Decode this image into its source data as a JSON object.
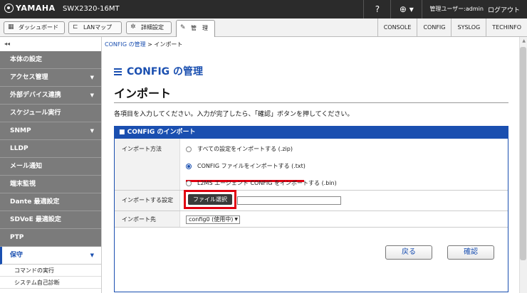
{
  "topbar": {
    "brand": "YAMAHA",
    "model": "SWX2320-16MT",
    "help": "?",
    "globe": "⊕ ▾",
    "user": "管理ユーザー:admin",
    "logout": "ログアウト"
  },
  "nav": {
    "dashboard": "ダッシュボード",
    "lanmap": "LANマップ",
    "detail": "詳細設定",
    "manage": "管　理",
    "links": [
      "CONSOLE",
      "CONFIG",
      "SYSLOG",
      "TECHINFO"
    ]
  },
  "collapse": "◂◂",
  "sidebar": {
    "items": [
      {
        "label": "本体の設定",
        "arrow": ""
      },
      {
        "label": "アクセス管理",
        "arrow": "▼"
      },
      {
        "label": "外部デバイス連携",
        "arrow": "▼"
      },
      {
        "label": "スケジュール実行",
        "arrow": ""
      },
      {
        "label": "SNMP",
        "arrow": "▼"
      },
      {
        "label": "LLDP",
        "arrow": ""
      },
      {
        "label": "メール通知",
        "arrow": ""
      },
      {
        "label": "端末監視",
        "arrow": ""
      },
      {
        "label": "Dante 最適設定",
        "arrow": ""
      },
      {
        "label": "SDVoE 最適設定",
        "arrow": ""
      },
      {
        "label": "PTP",
        "arrow": ""
      }
    ],
    "active": {
      "label": "保守",
      "arrow": "▼"
    },
    "subitems": [
      "コマンドの実行",
      "システム自己診断"
    ]
  },
  "breadcrumb": {
    "link": "CONFIG の管理",
    "sep": " > ",
    "current": "インポート"
  },
  "page": {
    "title": "CONFIG の管理",
    "subtitle": "インポート",
    "description": "各項目を入力してください。入力が完了したら、「確認」ボタンを押してください。"
  },
  "panel": {
    "header": "■ CONFIG のインポート",
    "method_label": "インポート方法",
    "options": [
      "すべての設定をインポートする (.zip)",
      "CONFIG ファイルをインポートする (.txt)",
      "L2MS エージェント CONFIG をインポートする (.bin)"
    ],
    "selected_option": 1,
    "file_label": "インポートする設定",
    "file_button": "ファイル選択",
    "dest_label": "インポート先",
    "dest_value": "config0 (使用中)",
    "back_button": "戻る",
    "confirm_button": "確認"
  },
  "colors": {
    "accent": "#1a4fb0",
    "highlight": "#e00010",
    "sidebar": "#7b7b7b",
    "topbar": "#2b2b2b"
  }
}
